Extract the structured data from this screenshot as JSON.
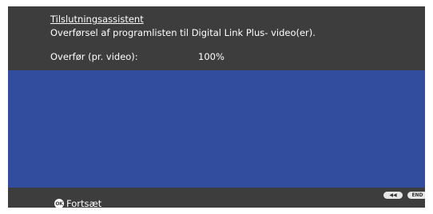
{
  "wizard": {
    "title": "Tilslutningsassistent",
    "subtitle": "Overførsel af programlisten til Digital Link Plus- video(er).",
    "progress_label": "Overfør (pr. video):",
    "progress_value": "100%"
  },
  "footer": {
    "ok_icon_text": "OK",
    "continue_label": "Fortsæt",
    "back_icon_text": "◀◀",
    "end_label": "END"
  },
  "colors": {
    "background": "#3d3d3d",
    "content_panel": "#324c9e",
    "text": "#ffffff"
  },
  "icons": {
    "ok": "ok-button-icon",
    "back": "rewind-back-icon",
    "end": "end-button-icon"
  }
}
